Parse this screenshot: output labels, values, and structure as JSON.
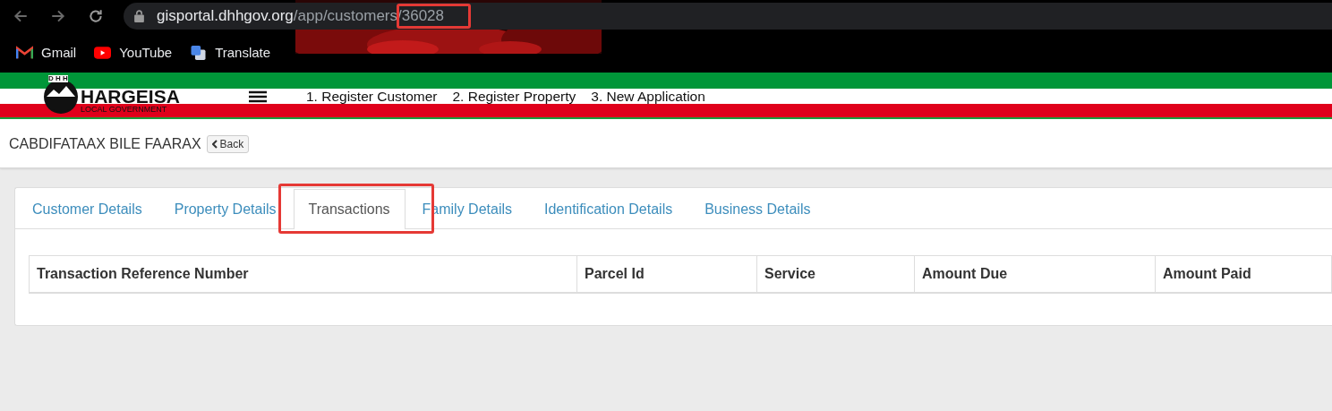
{
  "browser": {
    "url_host": "gisportal.dhhgov.org",
    "url_path": "/app/customers/",
    "url_id": "36028",
    "bookmarks": [
      {
        "label": "Gmail",
        "kind": "gmail"
      },
      {
        "label": "YouTube",
        "kind": "youtube"
      },
      {
        "label": "Translate",
        "kind": "translate"
      }
    ]
  },
  "header": {
    "logo_initials": "D H H",
    "logo_title": "HARGEISA",
    "logo_subtitle": "LOCAL GOVERNMENT",
    "nav": [
      "1. Register Customer",
      "2. Register Property",
      "3. New Application"
    ]
  },
  "page": {
    "title": "CABDIFATAAX BILE FAARAX",
    "back_button": "Back"
  },
  "tabs": [
    {
      "label": "Customer Details",
      "selected": false
    },
    {
      "label": "Property Details",
      "selected": false
    },
    {
      "label": "Transactions",
      "selected": true
    },
    {
      "label": "Family Details",
      "selected": false
    },
    {
      "label": "Identification Details",
      "selected": false
    },
    {
      "label": "Business Details",
      "selected": false
    }
  ],
  "table": {
    "columns": [
      "Transaction Reference Number",
      "Parcel Id",
      "Service",
      "Amount Due",
      "Amount Paid"
    ]
  }
}
